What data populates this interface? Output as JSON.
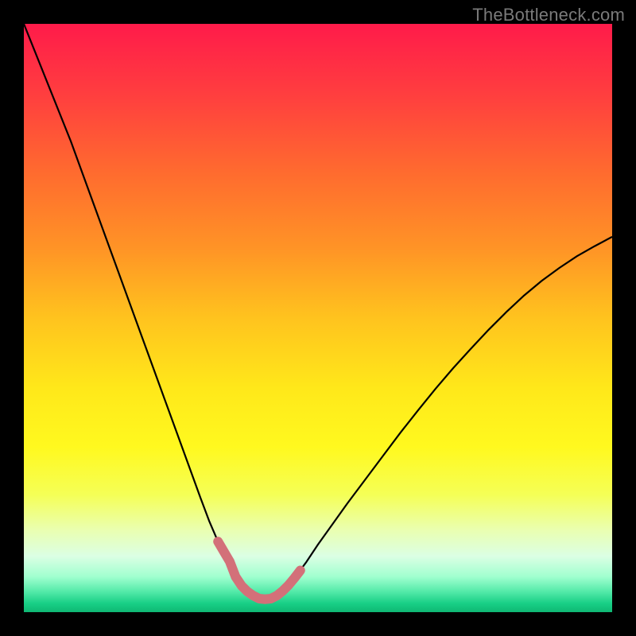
{
  "watermark": "TheBottleneck.com",
  "chart_data": {
    "type": "line",
    "title": "",
    "xlabel": "",
    "ylabel": "",
    "xlim": [
      0,
      100
    ],
    "ylim": [
      0,
      100
    ],
    "grid": false,
    "legend": false,
    "background_gradient": {
      "stops": [
        {
          "offset": 0.0,
          "color": "#ff1b4a"
        },
        {
          "offset": 0.12,
          "color": "#ff3e3f"
        },
        {
          "offset": 0.25,
          "color": "#ff6a2f"
        },
        {
          "offset": 0.38,
          "color": "#ff9326"
        },
        {
          "offset": 0.5,
          "color": "#ffc31e"
        },
        {
          "offset": 0.62,
          "color": "#ffe81a"
        },
        {
          "offset": 0.72,
          "color": "#fff91f"
        },
        {
          "offset": 0.8,
          "color": "#f5ff56"
        },
        {
          "offset": 0.86,
          "color": "#eaffb0"
        },
        {
          "offset": 0.905,
          "color": "#dbffe4"
        },
        {
          "offset": 0.94,
          "color": "#a0ffcf"
        },
        {
          "offset": 0.965,
          "color": "#54eaa9"
        },
        {
          "offset": 0.985,
          "color": "#18cf86"
        },
        {
          "offset": 1.0,
          "color": "#0fb873"
        }
      ]
    },
    "series": [
      {
        "name": "bottleneck-curve",
        "stroke": "#000000",
        "stroke_width": 2.2,
        "x": [
          0.0,
          2.0,
          4.0,
          6.0,
          8.0,
          10.0,
          12.0,
          14.0,
          16.0,
          18.0,
          20.0,
          22.0,
          24.0,
          26.0,
          28.0,
          30.0,
          31.5,
          33.0,
          34.5,
          36.0,
          37.0,
          38.0,
          39.0,
          40.0,
          41.0,
          42.0,
          43.0,
          44.0,
          46.0,
          48.0,
          50.0,
          52.5,
          55.0,
          58.0,
          61.0,
          64.0,
          67.0,
          70.0,
          73.0,
          76.0,
          79.0,
          82.0,
          85.0,
          88.0,
          91.0,
          94.0,
          97.0,
          100.0
        ],
        "y": [
          100.0,
          95.0,
          90.0,
          85.0,
          80.0,
          74.5,
          69.0,
          63.5,
          58.0,
          52.5,
          47.0,
          41.5,
          36.0,
          30.5,
          25.0,
          19.5,
          15.5,
          12.0,
          9.0,
          6.0,
          4.5,
          3.5,
          2.8,
          2.3,
          2.2,
          2.3,
          2.8,
          3.6,
          5.8,
          8.5,
          11.5,
          15.0,
          18.5,
          22.5,
          26.5,
          30.5,
          34.3,
          38.0,
          41.5,
          44.8,
          48.0,
          51.0,
          53.8,
          56.3,
          58.5,
          60.5,
          62.2,
          63.8
        ]
      },
      {
        "name": "valley-highlight",
        "stroke": "#d37079",
        "stroke_width": 12,
        "linecap": "round",
        "x": [
          33.0,
          34.0,
          35.0,
          36.0,
          37.0,
          38.0,
          39.0,
          40.0,
          41.0,
          42.0,
          43.0,
          44.0,
          45.0,
          46.0,
          47.0
        ],
        "y": [
          12.0,
          10.3,
          8.6,
          6.0,
          4.5,
          3.5,
          2.8,
          2.3,
          2.2,
          2.3,
          2.8,
          3.6,
          4.6,
          5.8,
          7.1
        ]
      }
    ]
  }
}
